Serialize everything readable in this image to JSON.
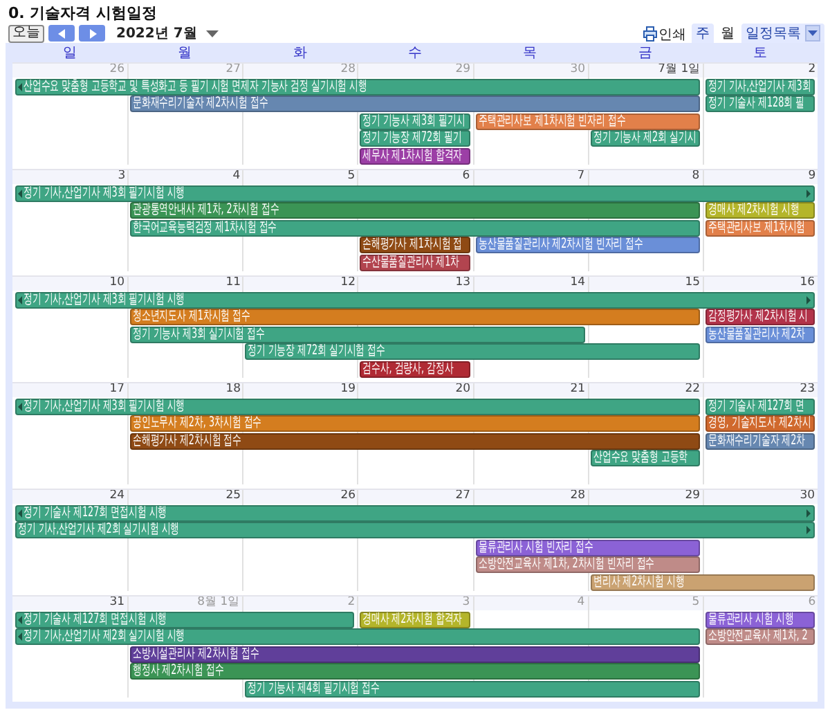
{
  "title": "0. 기술자격 시험일정",
  "toolbar": {
    "today_button": "오늘",
    "month_label": "2022년 7월",
    "print_label": "인쇄",
    "view_tabs": [
      {
        "label": "주",
        "selected": false
      },
      {
        "label": "월",
        "selected": true
      },
      {
        "label": "일정목록",
        "selected": false
      }
    ]
  },
  "weekdays": [
    "일",
    "월",
    "화",
    "수",
    "목",
    "금",
    "토"
  ],
  "weeks": [
    {
      "days": [
        {
          "label": "26",
          "other_month": true
        },
        {
          "label": "27",
          "other_month": true
        },
        {
          "label": "28",
          "other_month": true
        },
        {
          "label": "29",
          "other_month": true
        },
        {
          "label": "30",
          "other_month": true
        },
        {
          "label": "7월 1일",
          "other_month": false
        },
        {
          "label": "2",
          "other_month": false
        }
      ],
      "lanes": [
        [
          {
            "kind": "event",
            "title": "산업수요 맞춤형 고등학교 및 특성화고 등 필기 시험 면제자 기능사 검정 실기시험 시행",
            "color": "#3fa584",
            "continues_before": true,
            "continues_after": false
          },
          {
            "kind": "more"
          },
          {
            "kind": "more"
          },
          {
            "kind": "more"
          },
          {
            "kind": "more"
          },
          {
            "kind": "more"
          },
          {
            "kind": "event",
            "title": "정기 기사,산업기사 제3회",
            "color": "#3fa584",
            "continues_before": false,
            "continues_after": false
          }
        ],
        [
          {
            "kind": "empty"
          },
          {
            "kind": "event",
            "title": "문화재수리기술자 제2차시험 접수",
            "color": "#6687b0",
            "continues_before": false,
            "continues_after": false
          },
          {
            "kind": "more"
          },
          {
            "kind": "more"
          },
          {
            "kind": "more"
          },
          {
            "kind": "more"
          },
          {
            "kind": "event",
            "title": "정기 기술사 제128회 필",
            "color": "#3fa584",
            "continues_before": false,
            "continues_after": false
          }
        ],
        [
          {
            "kind": "empty"
          },
          {
            "kind": "empty"
          },
          {
            "kind": "empty"
          },
          {
            "kind": "event",
            "title": "정기 기능사 제3회 필기시",
            "color": "#3fa584",
            "continues_before": false,
            "continues_after": false
          },
          {
            "kind": "event",
            "title": "주택관리사보 제1차시험 빈자리 접수",
            "color": "#e2804a",
            "continues_before": false,
            "continues_after": false
          },
          {
            "kind": "more"
          }
        ],
        [
          {
            "kind": "empty"
          },
          {
            "kind": "empty"
          },
          {
            "kind": "empty"
          },
          {
            "kind": "event",
            "title": "정기 기능장 제72회 필기",
            "color": "#3fa584",
            "continues_before": false,
            "continues_after": false
          },
          {
            "kind": "empty"
          },
          {
            "kind": "event",
            "title": "정기 기능사 제2회 실기시",
            "color": "#3fa584",
            "continues_before": false,
            "continues_after": false
          }
        ],
        [
          {
            "kind": "empty"
          },
          {
            "kind": "empty"
          },
          {
            "kind": "empty"
          },
          {
            "kind": "event",
            "title": "세무사 제1차시험 합격자",
            "color": "#9c3fa6",
            "continues_before": false,
            "continues_after": false
          }
        ]
      ]
    },
    {
      "days": [
        {
          "label": "3",
          "other_month": false
        },
        {
          "label": "4",
          "other_month": false
        },
        {
          "label": "5",
          "other_month": false
        },
        {
          "label": "6",
          "other_month": false
        },
        {
          "label": "7",
          "other_month": false
        },
        {
          "label": "8",
          "other_month": false
        },
        {
          "label": "9",
          "other_month": false
        }
      ],
      "lanes": [
        [
          {
            "kind": "event",
            "title": "정기 기사,산업기사 제3회 필기시험 시행",
            "color": "#3fa584",
            "continues_before": true,
            "continues_after": true
          },
          {
            "kind": "more"
          },
          {
            "kind": "more"
          },
          {
            "kind": "more"
          },
          {
            "kind": "more"
          },
          {
            "kind": "more"
          },
          {
            "kind": "more"
          }
        ],
        [
          {
            "kind": "empty"
          },
          {
            "kind": "event",
            "title": "관광통역안내사 제1차, 2차시험 접수",
            "color": "#3b9455",
            "continues_before": false,
            "continues_after": false
          },
          {
            "kind": "more"
          },
          {
            "kind": "more"
          },
          {
            "kind": "more"
          },
          {
            "kind": "more"
          },
          {
            "kind": "event",
            "title": "경매사 제2차시험 시행",
            "color": "#b4b52a",
            "continues_before": false,
            "continues_after": false
          }
        ],
        [
          {
            "kind": "empty"
          },
          {
            "kind": "event",
            "title": "한국어교육능력검정 제1차시험 접수",
            "color": "#3fa584",
            "continues_before": false,
            "continues_after": false
          },
          {
            "kind": "more"
          },
          {
            "kind": "more"
          },
          {
            "kind": "more"
          },
          {
            "kind": "more"
          },
          {
            "kind": "event",
            "title": "주택관리사보 제1차시험",
            "color": "#e2804a",
            "continues_before": false,
            "continues_after": false
          }
        ],
        [
          {
            "kind": "empty"
          },
          {
            "kind": "empty"
          },
          {
            "kind": "empty"
          },
          {
            "kind": "event",
            "title": "손해평가사 제1차시험 접",
            "color": "#8f4a14",
            "continues_before": false,
            "continues_after": false
          },
          {
            "kind": "event",
            "title": "농산물품질관리사 제2차시험 빈자리 접수",
            "color": "#6a8fd8",
            "continues_before": false,
            "continues_after": false
          },
          {
            "kind": "more"
          }
        ],
        [
          {
            "kind": "empty"
          },
          {
            "kind": "empty"
          },
          {
            "kind": "empty"
          },
          {
            "kind": "event",
            "title": "수산물품질관리사 제1차",
            "color": "#b2444f",
            "continues_before": false,
            "continues_after": false
          }
        ]
      ]
    },
    {
      "days": [
        {
          "label": "10",
          "other_month": false
        },
        {
          "label": "11",
          "other_month": false
        },
        {
          "label": "12",
          "other_month": false
        },
        {
          "label": "13",
          "other_month": false
        },
        {
          "label": "14",
          "other_month": false
        },
        {
          "label": "15",
          "other_month": false
        },
        {
          "label": "16",
          "other_month": false
        }
      ],
      "lanes": [
        [
          {
            "kind": "event",
            "title": "정기 기사,산업기사 제3회 필기시험 시행",
            "color": "#3fa584",
            "continues_before": true,
            "continues_after": true
          },
          {
            "kind": "more"
          },
          {
            "kind": "more"
          },
          {
            "kind": "more"
          },
          {
            "kind": "more"
          },
          {
            "kind": "more"
          },
          {
            "kind": "more"
          }
        ],
        [
          {
            "kind": "empty"
          },
          {
            "kind": "event",
            "title": "청소년지도사 제1차시험 접수",
            "color": "#d47d1f",
            "continues_before": false,
            "continues_after": false
          },
          {
            "kind": "more"
          },
          {
            "kind": "more"
          },
          {
            "kind": "more"
          },
          {
            "kind": "more"
          },
          {
            "kind": "event",
            "title": "감정평가사 제2차시험 시",
            "color": "#b2334a",
            "continues_before": false,
            "continues_after": false
          }
        ],
        [
          {
            "kind": "empty"
          },
          {
            "kind": "event",
            "title": "정기 기능사 제3회 실기시험 접수",
            "color": "#3fa584",
            "continues_before": false,
            "continues_after": false
          },
          {
            "kind": "more"
          },
          {
            "kind": "more"
          },
          {
            "kind": "more"
          },
          {
            "kind": "empty"
          },
          {
            "kind": "event",
            "title": "농산물품질관리사 제2차",
            "color": "#6a8fd8",
            "continues_before": false,
            "continues_after": false
          }
        ],
        [
          {
            "kind": "empty"
          },
          {
            "kind": "empty"
          },
          {
            "kind": "event",
            "title": "정기 기능장 제72회 실기시험 접수",
            "color": "#3fa584",
            "continues_before": false,
            "continues_after": false
          },
          {
            "kind": "more"
          },
          {
            "kind": "more"
          },
          {
            "kind": "more"
          }
        ],
        [
          {
            "kind": "empty"
          },
          {
            "kind": "empty"
          },
          {
            "kind": "empty"
          },
          {
            "kind": "event",
            "title": "검수사, 검량사, 감정사",
            "color": "#b02a34",
            "continues_before": false,
            "continues_after": false
          }
        ]
      ]
    },
    {
      "days": [
        {
          "label": "17",
          "other_month": false
        },
        {
          "label": "18",
          "other_month": false
        },
        {
          "label": "19",
          "other_month": false
        },
        {
          "label": "20",
          "other_month": false
        },
        {
          "label": "21",
          "other_month": false
        },
        {
          "label": "22",
          "other_month": false
        },
        {
          "label": "23",
          "other_month": false
        }
      ],
      "lanes": [
        [
          {
            "kind": "event",
            "title": "정기 기사,산업기사 제3회 필기시험 시행",
            "color": "#3fa584",
            "continues_before": true,
            "continues_after": false
          },
          {
            "kind": "more"
          },
          {
            "kind": "more"
          },
          {
            "kind": "more"
          },
          {
            "kind": "more"
          },
          {
            "kind": "more"
          },
          {
            "kind": "event",
            "title": "정기 기술사 제127회 면",
            "color": "#3fa584",
            "continues_before": false,
            "continues_after": false
          }
        ],
        [
          {
            "kind": "empty"
          },
          {
            "kind": "event",
            "title": "공인노무사 제2차, 3차시험 접수",
            "color": "#d47d1f",
            "continues_before": false,
            "continues_after": false
          },
          {
            "kind": "more"
          },
          {
            "kind": "more"
          },
          {
            "kind": "more"
          },
          {
            "kind": "more"
          },
          {
            "kind": "event",
            "title": "경영, 기술지도사 제2차시",
            "color": "#d0692d",
            "continues_before": false,
            "continues_after": false
          }
        ],
        [
          {
            "kind": "empty"
          },
          {
            "kind": "event",
            "title": "손해평가사 제2차시험 접수",
            "color": "#8f4a14",
            "continues_before": false,
            "continues_after": false
          },
          {
            "kind": "more"
          },
          {
            "kind": "more"
          },
          {
            "kind": "more"
          },
          {
            "kind": "more"
          },
          {
            "kind": "event",
            "title": "문화재수리기술자 제2차",
            "color": "#6687b0",
            "continues_before": false,
            "continues_after": false
          }
        ],
        [
          {
            "kind": "empty"
          },
          {
            "kind": "empty"
          },
          {
            "kind": "empty"
          },
          {
            "kind": "empty"
          },
          {
            "kind": "empty"
          },
          {
            "kind": "event",
            "title": "산업수요 맞춤형 고등학",
            "color": "#3fa584",
            "continues_before": false,
            "continues_after": false
          }
        ]
      ]
    },
    {
      "days": [
        {
          "label": "24",
          "other_month": false
        },
        {
          "label": "25",
          "other_month": false
        },
        {
          "label": "26",
          "other_month": false
        },
        {
          "label": "27",
          "other_month": false
        },
        {
          "label": "28",
          "other_month": false
        },
        {
          "label": "29",
          "other_month": false
        },
        {
          "label": "30",
          "other_month": false
        }
      ],
      "lanes": [
        [
          {
            "kind": "event",
            "title": "정기 기술사 제127회 면접시험 시행",
            "color": "#3fa584",
            "continues_before": true,
            "continues_after": true
          },
          {
            "kind": "more"
          },
          {
            "kind": "more"
          },
          {
            "kind": "more"
          },
          {
            "kind": "more"
          },
          {
            "kind": "more"
          },
          {
            "kind": "more"
          }
        ],
        [
          {
            "kind": "event",
            "title": "정기 기사,산업기사 제2회 실기시험 시행",
            "color": "#3fa584",
            "continues_before": false,
            "continues_after": true
          },
          {
            "kind": "more"
          },
          {
            "kind": "more"
          },
          {
            "kind": "more"
          },
          {
            "kind": "more"
          },
          {
            "kind": "more"
          },
          {
            "kind": "more"
          }
        ],
        [
          {
            "kind": "empty"
          },
          {
            "kind": "empty"
          },
          {
            "kind": "empty"
          },
          {
            "kind": "empty"
          },
          {
            "kind": "event",
            "title": "물류관리사 시험 빈자리 접수",
            "color": "#8b62d6",
            "continues_before": false,
            "continues_after": false
          },
          {
            "kind": "more"
          }
        ],
        [
          {
            "kind": "empty"
          },
          {
            "kind": "empty"
          },
          {
            "kind": "empty"
          },
          {
            "kind": "empty"
          },
          {
            "kind": "event",
            "title": "소방안전교육사 제1차, 2차시험 빈자리 접수",
            "color": "#bf8b88",
            "continues_before": false,
            "continues_after": false
          },
          {
            "kind": "more"
          }
        ],
        [
          {
            "kind": "empty"
          },
          {
            "kind": "empty"
          },
          {
            "kind": "empty"
          },
          {
            "kind": "empty"
          },
          {
            "kind": "empty"
          },
          {
            "kind": "event",
            "title": "변리사 제2차시험 시행",
            "color": "#caa271",
            "continues_before": false,
            "continues_after": false
          },
          {
            "kind": "more"
          }
        ]
      ]
    },
    {
      "days": [
        {
          "label": "31",
          "other_month": false
        },
        {
          "label": "8월 1일",
          "other_month": true
        },
        {
          "label": "2",
          "other_month": true
        },
        {
          "label": "3",
          "other_month": true
        },
        {
          "label": "4",
          "other_month": true
        },
        {
          "label": "5",
          "other_month": true
        },
        {
          "label": "6",
          "other_month": true
        }
      ],
      "lanes": [
        [
          {
            "kind": "event",
            "title": "정기 기술사 제127회 면접시험 시행",
            "color": "#3fa584",
            "continues_before": true,
            "continues_after": false
          },
          {
            "kind": "more"
          },
          {
            "kind": "more"
          },
          {
            "kind": "event",
            "title": "경매사 제2차시험 합격자",
            "color": "#b4b52a",
            "continues_before": false,
            "continues_after": false
          },
          {
            "kind": "empty"
          },
          {
            "kind": "empty"
          },
          {
            "kind": "event",
            "title": "물류관리사 시험 시행",
            "color": "#8b62d6",
            "continues_before": false,
            "continues_after": false
          }
        ],
        [
          {
            "kind": "event",
            "title": "정기 기사,산업기사 제2회 실기시험 시행",
            "color": "#3fa584",
            "continues_before": true,
            "continues_after": false
          },
          {
            "kind": "more"
          },
          {
            "kind": "more"
          },
          {
            "kind": "more"
          },
          {
            "kind": "more"
          },
          {
            "kind": "more"
          },
          {
            "kind": "event",
            "title": "소방안전교육사 제1차, 2",
            "color": "#bf8b88",
            "continues_before": false,
            "continues_after": false
          }
        ],
        [
          {
            "kind": "empty"
          },
          {
            "kind": "event",
            "title": "소방시설관리사 제2차시험 접수",
            "color": "#603f9a",
            "continues_before": false,
            "continues_after": false
          },
          {
            "kind": "more"
          },
          {
            "kind": "more"
          },
          {
            "kind": "more"
          },
          {
            "kind": "more"
          }
        ],
        [
          {
            "kind": "empty"
          },
          {
            "kind": "event",
            "title": "행정사 제2차시험 접수",
            "color": "#3b9455",
            "continues_before": false,
            "continues_after": false
          },
          {
            "kind": "more"
          },
          {
            "kind": "more"
          },
          {
            "kind": "more"
          },
          {
            "kind": "more"
          }
        ],
        [
          {
            "kind": "empty"
          },
          {
            "kind": "empty"
          },
          {
            "kind": "event",
            "title": "정기 기능사 제4회 필기시험 접수",
            "color": "#3fa584",
            "continues_before": false,
            "continues_after": false
          },
          {
            "kind": "more"
          },
          {
            "kind": "more"
          },
          {
            "kind": "more"
          }
        ]
      ]
    }
  ]
}
